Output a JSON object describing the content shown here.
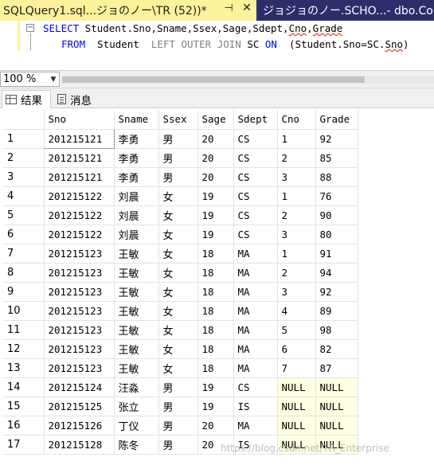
{
  "window": {
    "active_tab_title": "SQLQuery1.sql...ジョのノー\\TR (52))*",
    "active_tab_pin": "⊣",
    "active_tab_close": "✕",
    "inactive_tab_title": "ジョジョのノー.SCHO...- dbo.Co"
  },
  "editor": {
    "line1_keyword": "SELECT",
    "line1_cols_a": " Student.Sno,Sname,Ssex,Sage,Sdept,",
    "line1_cno": "Cno",
    "line1_comma": ",",
    "line1_grade": "Grade",
    "line2_from": "FROM",
    "line2_table": "  Student  ",
    "line2_join": "LEFT OUTER JOIN",
    "line2_sc": " SC ",
    "line2_on": "ON",
    "line2_cond_a": "  (Student.Sno=SC.",
    "line2_cond_sno": "Sno",
    "line2_close": ")"
  },
  "zoom": {
    "value": "100 %"
  },
  "result_tabs": {
    "results_label": "结果",
    "messages_label": "消息"
  },
  "grid": {
    "columns": [
      "",
      "Sno",
      "Sname",
      "Ssex",
      "Sage",
      "Sdept",
      "Cno",
      "Grade"
    ],
    "rows": [
      [
        "1",
        "201215121",
        "李勇",
        "男",
        "20",
        "CS",
        "1",
        "92"
      ],
      [
        "2",
        "201215121",
        "李勇",
        "男",
        "20",
        "CS",
        "2",
        "85"
      ],
      [
        "3",
        "201215121",
        "李勇",
        "男",
        "20",
        "CS",
        "3",
        "88"
      ],
      [
        "4",
        "201215122",
        "刘晨",
        "女",
        "19",
        "CS",
        "1",
        "76"
      ],
      [
        "5",
        "201215122",
        "刘晨",
        "女",
        "19",
        "CS",
        "2",
        "90"
      ],
      [
        "6",
        "201215122",
        "刘晨",
        "女",
        "19",
        "CS",
        "3",
        "80"
      ],
      [
        "7",
        "201215123",
        "王敏",
        "女",
        "18",
        "MA",
        "1",
        "91"
      ],
      [
        "8",
        "201215123",
        "王敏",
        "女",
        "18",
        "MA",
        "2",
        "94"
      ],
      [
        "9",
        "201215123",
        "王敏",
        "女",
        "18",
        "MA",
        "3",
        "92"
      ],
      [
        "10",
        "201215123",
        "王敏",
        "女",
        "18",
        "MA",
        "4",
        "89"
      ],
      [
        "11",
        "201215123",
        "王敏",
        "女",
        "18",
        "MA",
        "5",
        "98"
      ],
      [
        "12",
        "201215123",
        "王敏",
        "女",
        "18",
        "MA",
        "6",
        "82"
      ],
      [
        "13",
        "201215123",
        "王敏",
        "女",
        "18",
        "MA",
        "7",
        "87"
      ],
      [
        "14",
        "201215124",
        "汪淼",
        "男",
        "19",
        "CS",
        "NULL",
        "NULL"
      ],
      [
        "15",
        "201215125",
        "张立",
        "男",
        "19",
        "IS",
        "NULL",
        "NULL"
      ],
      [
        "16",
        "201215126",
        "丁仪",
        "男",
        "20",
        "MA",
        "NULL",
        "NULL"
      ],
      [
        "17",
        "201215128",
        "陈冬",
        "男",
        "20",
        "IS",
        "NULL",
        "NULL"
      ]
    ]
  },
  "watermark": "https://blog.csdn.net/TR_Enterprise",
  "colors": {
    "tab_strip": "#2d2d6b",
    "active_tab": "#fcf29a",
    "keyword": "#0000ff",
    "null_cell": "#ffffe1"
  }
}
